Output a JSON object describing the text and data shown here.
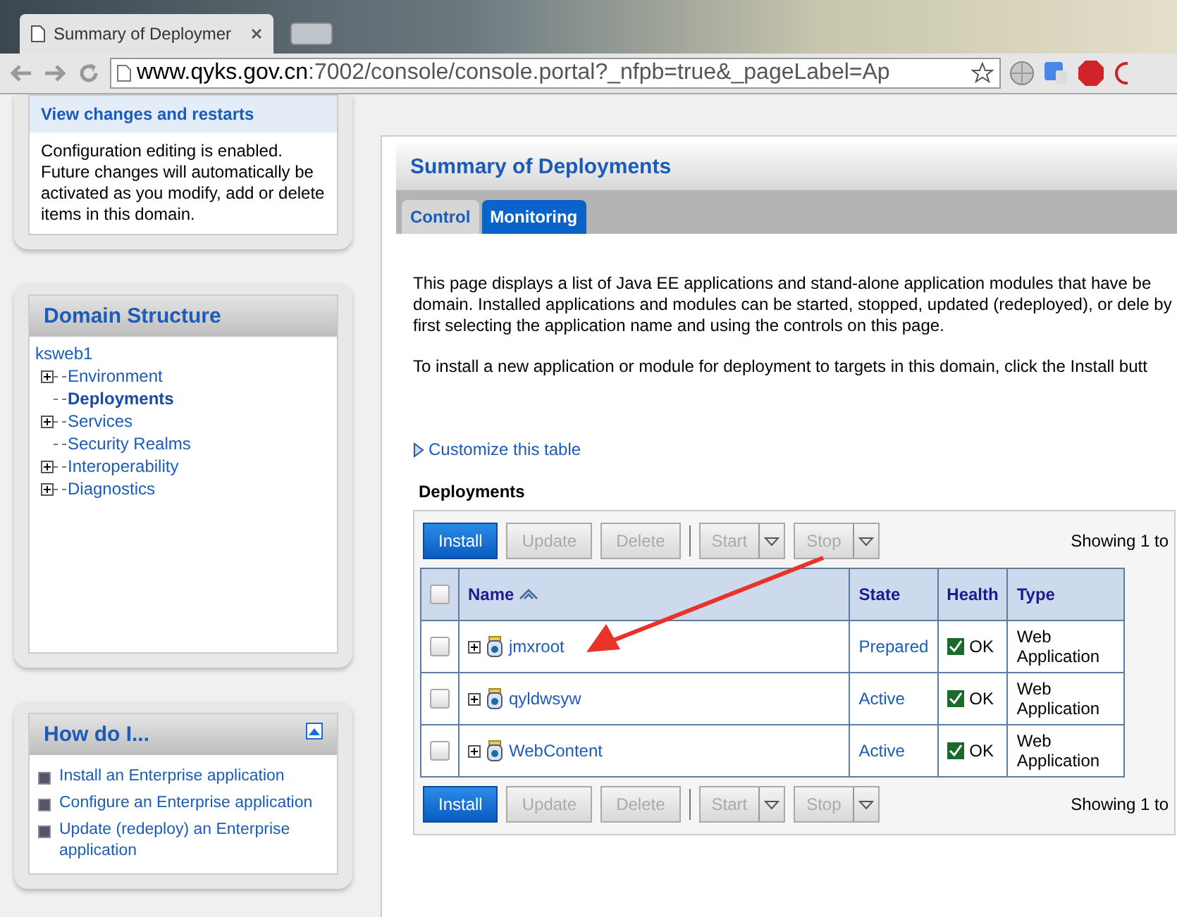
{
  "browser": {
    "tab_title": "Summary of Deploymer",
    "url_host": "www.qyks.gov.cn",
    "url_path": ":7002/console/console.portal?_nfpb=true&_pageLabel=Ap"
  },
  "change_center": {
    "title": "View changes and restarts",
    "text": "Configuration editing is enabled. Future changes will automatically be activated as you modify, add or delete items in this domain."
  },
  "domain_structure": {
    "title": "Domain Structure",
    "root": "ksweb1",
    "items": [
      {
        "label": "Environment",
        "expandable": true,
        "selected": false
      },
      {
        "label": "Deployments",
        "expandable": false,
        "selected": true
      },
      {
        "label": "Services",
        "expandable": true,
        "selected": false
      },
      {
        "label": "Security Realms",
        "expandable": false,
        "selected": false
      },
      {
        "label": "Interoperability",
        "expandable": true,
        "selected": false
      },
      {
        "label": "Diagnostics",
        "expandable": true,
        "selected": false
      }
    ]
  },
  "how_do_i": {
    "title": "How do I...",
    "links": [
      "Install an Enterprise application",
      "Configure an Enterprise application",
      "Update (redeploy) an Enterprise application"
    ]
  },
  "main": {
    "title": "Summary of Deployments",
    "tabs": [
      {
        "label": "Control",
        "selected": false
      },
      {
        "label": "Monitoring",
        "selected": true
      }
    ],
    "paragraphs": [
      "This page displays a list of Java EE applications and stand-alone application modules that have be domain. Installed applications and modules can be started, stopped, updated (redeployed), or dele by first selecting the application name and using the controls on this page.",
      "To install a new application or module for deployment to targets in this domain, click the Install butt"
    ],
    "customize_link": "Customize this table",
    "table_title": "Deployments",
    "toolbars": [
      {
        "showing": "Showing 1 to",
        "buttons": [
          {
            "label": "Install",
            "disabled": false,
            "dropdown": false
          },
          {
            "label": "Update",
            "disabled": true,
            "dropdown": false
          },
          {
            "label": "Delete",
            "disabled": true,
            "dropdown": false
          },
          {
            "label": "Start",
            "disabled": true,
            "dropdown": true
          },
          {
            "label": "Stop",
            "disabled": true,
            "dropdown": true
          }
        ]
      },
      {
        "showing": "Showing 1 to",
        "buttons": [
          {
            "label": "Install",
            "disabled": false,
            "dropdown": false
          },
          {
            "label": "Update",
            "disabled": true,
            "dropdown": false
          },
          {
            "label": "Delete",
            "disabled": true,
            "dropdown": false
          },
          {
            "label": "Start",
            "disabled": true,
            "dropdown": true
          },
          {
            "label": "Stop",
            "disabled": true,
            "dropdown": true
          }
        ]
      }
    ],
    "select_all_checked": false,
    "columns": [
      "Name",
      "State",
      "Health",
      "Type"
    ],
    "rows": [
      {
        "checked": false,
        "name": "jmxroot",
        "state": "Prepared",
        "health": "OK",
        "type": "Web Application"
      },
      {
        "checked": false,
        "name": "qyldwsyw",
        "state": "Active",
        "health": "OK",
        "type": "Web Application"
      },
      {
        "checked": false,
        "name": "WebContent",
        "state": "Active",
        "health": "OK",
        "type": "Web Application"
      }
    ]
  }
}
